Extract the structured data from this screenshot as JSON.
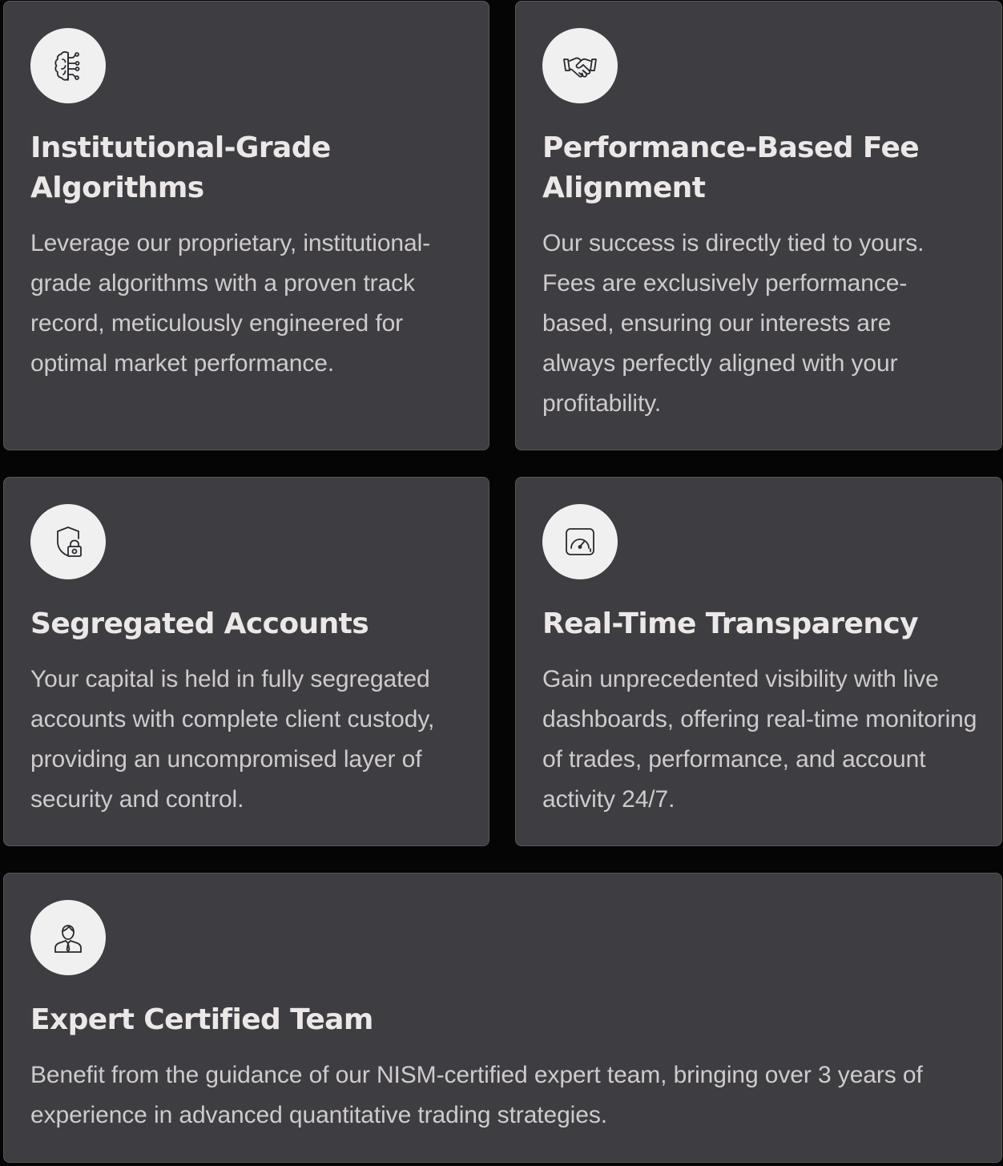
{
  "features": [
    {
      "icon": "brain-circuit-icon",
      "title_line1": "Institutional-Grade",
      "title_line2": "Algorithms",
      "description": "Leverage our proprietary, institutional-grade algorithms with a proven track record, meticulously engineered for optimal market performance."
    },
    {
      "icon": "handshake-icon",
      "title_line1": "Performance-Based Fee",
      "title_line2": "Alignment",
      "description": "Our success is directly tied to yours. Fees are exclusively performance-based, ensuring our interests are always perfectly aligned with your profitability."
    },
    {
      "icon": "shield-lock-icon",
      "title": "Segregated Accounts",
      "description": "Your capital is held in fully segregated accounts with complete client custody, providing an uncompromised layer of security and control."
    },
    {
      "icon": "speedometer-dashboard-icon",
      "title": "Real-Time Transparency",
      "description": "Gain unprecedented visibility with live dashboards, offering real-time monitoring of trades, performance, and account activity 24/7."
    },
    {
      "icon": "business-person-icon",
      "title": "Expert Certified Team",
      "description": "Benefit from the guidance of our NISM-certified expert team, bringing over 3 years of experience in advanced quantitative trading strategies."
    }
  ],
  "colors": {
    "page_background": "#050505",
    "card_background": "#3e3d42",
    "card_border": "#56555a",
    "icon_circle": "#f1f0f0",
    "icon_stroke": "#2a2a2e",
    "title_text": "#ece8e8",
    "body_text": "#cfcbcc"
  }
}
